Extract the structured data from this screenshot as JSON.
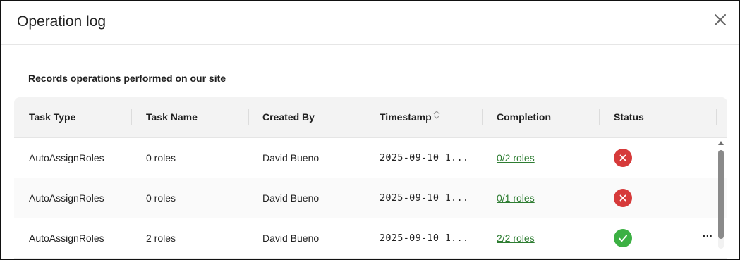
{
  "dialog": {
    "title": "Operation log",
    "subtitle": "Records operations performed on our site"
  },
  "table": {
    "columns": [
      "Task Type",
      "Task Name",
      "Created By",
      "Timestamp",
      "Completion",
      "Status"
    ],
    "sortable_column": "Timestamp",
    "rows": [
      {
        "task_type": "AutoAssignRoles",
        "task_name": "0 roles",
        "created_by": "David Bueno",
        "timestamp": "2025-09-10 1...",
        "completion": "0/2 roles",
        "status": "failed"
      },
      {
        "task_type": "AutoAssignRoles",
        "task_name": "0 roles",
        "created_by": "David Bueno",
        "timestamp": "2025-09-10 1...",
        "completion": "0/1 roles",
        "status": "failed"
      },
      {
        "task_type": "AutoAssignRoles",
        "task_name": "2 roles",
        "created_by": "David Bueno",
        "timestamp": "2025-09-10 1...",
        "completion": "2/2 roles",
        "status": "success"
      }
    ]
  },
  "more_label": "...",
  "icons": {
    "close": "close-icon",
    "sort": "sort-icon",
    "failed": "x-circle-icon",
    "success": "check-circle-icon"
  },
  "colors": {
    "link": "#2e7d32",
    "error": "#d63a3a",
    "success": "#3cb043",
    "header_bg": "#f3f3f3"
  }
}
